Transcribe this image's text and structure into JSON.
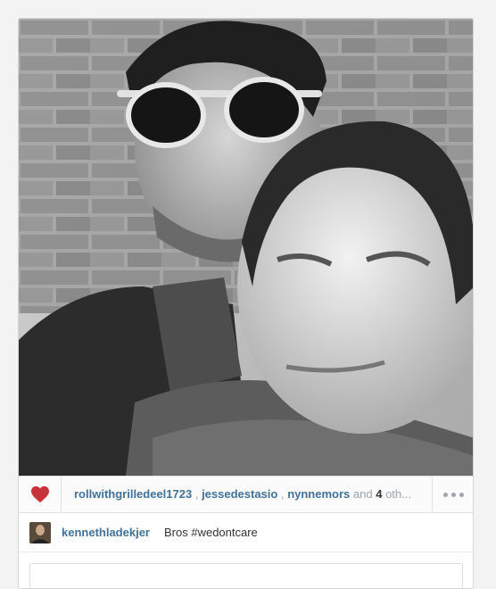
{
  "post": {
    "likers": [
      "rollwithgrilledeel1723",
      "jessedestasio",
      "nynnemors"
    ],
    "and_text": "and",
    "others_count": "4",
    "others_text": "oth..."
  },
  "caption": {
    "username": "kennethladekjer",
    "text": "Bros #wedontcare"
  },
  "colors": {
    "heart": "#c8333a",
    "link": "#3f729b"
  }
}
